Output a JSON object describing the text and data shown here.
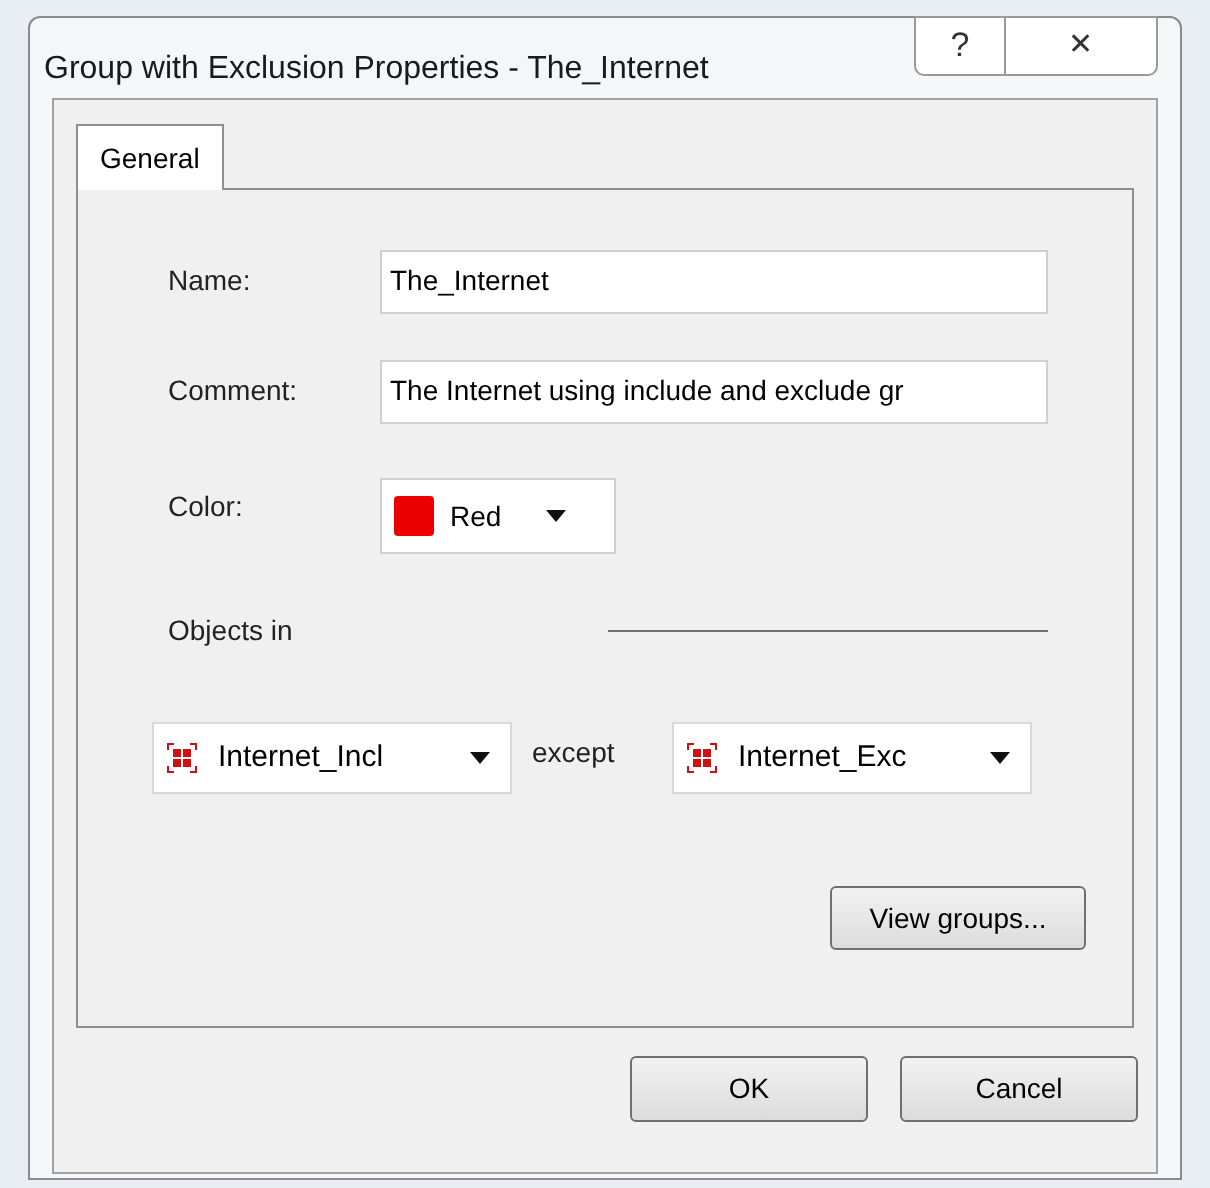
{
  "window": {
    "title": "Group with Exclusion Properties - The_Internet",
    "help_button": "?",
    "close_button": "✕"
  },
  "tabs": [
    {
      "label": "General",
      "selected": true
    }
  ],
  "fields": [
    {
      "label": "Name:",
      "value": "The_Internet"
    },
    {
      "label": "Comment:",
      "value": "The Internet using include and exclude gr"
    }
  ],
  "color": {
    "label": "Color:",
    "value": "Red",
    "color": "#ee0000"
  },
  "objects_in": {
    "label": "Objects in",
    "include": "Internet_Incl",
    "separator": "except",
    "exclude": "Internet_Exc"
  },
  "view_groups_button": "View groups...",
  "buttons": [
    "OK",
    "Cancel"
  ]
}
